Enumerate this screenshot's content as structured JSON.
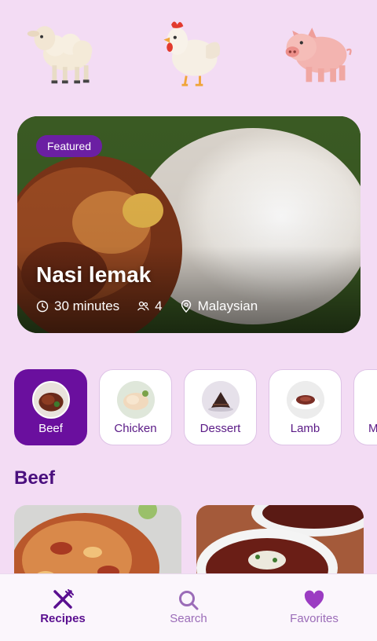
{
  "animals": [
    {
      "icon": "sheep-icon"
    },
    {
      "icon": "chicken-icon"
    },
    {
      "icon": "pig-icon"
    }
  ],
  "featured": {
    "badge": "Featured",
    "title": "Nasi lemak",
    "time": "30 minutes",
    "servings": "4",
    "cuisine": "Malaysian"
  },
  "categories": [
    {
      "label": "Beef",
      "active": true
    },
    {
      "label": "Chicken",
      "active": false
    },
    {
      "label": "Dessert",
      "active": false
    },
    {
      "label": "Lamb",
      "active": false
    },
    {
      "label": "M",
      "active": false
    }
  ],
  "section": {
    "title": "Beef"
  },
  "nav": {
    "recipes": "Recipes",
    "search": "Search",
    "favorites": "Favorites"
  },
  "colors": {
    "background": "#f3dcf4",
    "accent": "#6a0f9e",
    "section_title": "#4a0f7e",
    "nav_inactive": "#9b6cb8"
  }
}
